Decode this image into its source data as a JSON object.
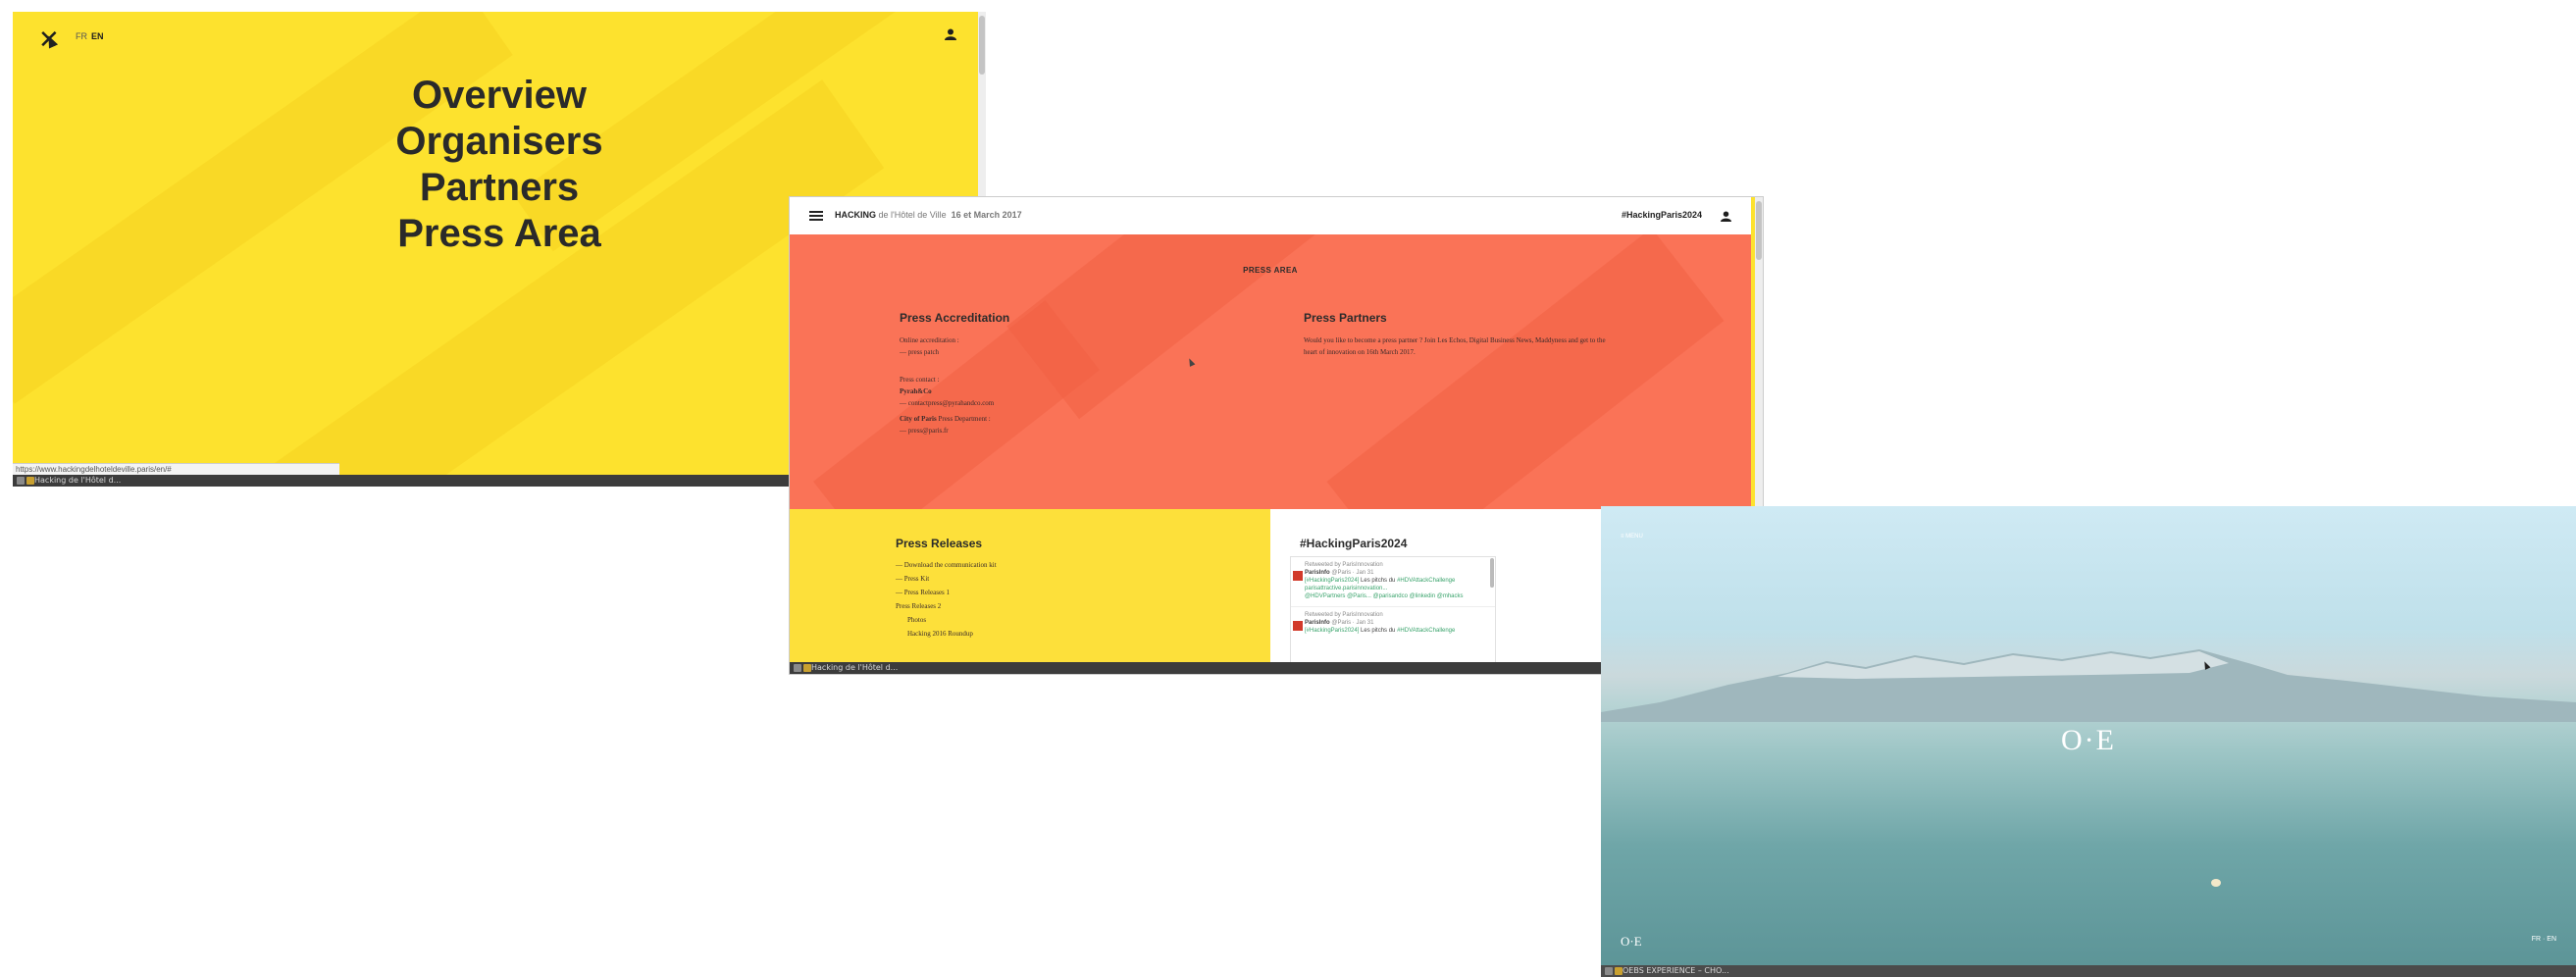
{
  "menu_window": {
    "close_glyph": "✕",
    "lang": [
      "FR",
      "EN"
    ],
    "active_lang": "EN",
    "nav": [
      "Overview",
      "Organisers",
      "Partners",
      "Press Area"
    ],
    "status_url": "https://www.hackingdelhoteldeville.paris/en/#",
    "taskbar_title": "Hacking de l'Hôtel d..."
  },
  "press_window": {
    "brand_bold": "HACKING",
    "brand_light": "de l'Hôtel de Ville",
    "brand_date": "16 et March 2017",
    "hashtag": "#HackingParis2024",
    "section_title": "PRESS AREA",
    "accreditation": {
      "title": "Press Accreditation",
      "online_label": "Online accreditation :",
      "online_link": "— press patch",
      "contact_label": "Press contact :",
      "contact_org": "Pyrah&Co",
      "contact_email": "— contactpress@pyrahandco.com",
      "city_bold": "City of Paris",
      "city_rest": "Press Department :",
      "city_email": "— press@paris.fr"
    },
    "partners": {
      "title": "Press Partners",
      "text_line1": "Would you like to become a press partner ? Join Les Echos, Digital Business News, Maddyness and get to the",
      "text_line2": "heart of innovation on 16th March 2017."
    },
    "releases": {
      "title": "Press Releases",
      "items": [
        "— Download the communication kit",
        "— Press Kit",
        "— Press Releases 1",
        "Press Releases 2",
        "Photos",
        "Hacking 2016 Roundup"
      ]
    },
    "twitter": {
      "title": "#HackingParis2024",
      "tweets": [
        {
          "retweet": "Retweeted by ParisInnovation",
          "author": "ParisInfo",
          "handle": "@Paris · Jan 31",
          "text_hl": "[#HackingParis2024]",
          "text": " Les pitchs du ",
          "text_hl2": "#HDVAttackChallenge",
          "text2": " parisattractive.parisinnovation...",
          "text3": "@HDVPartners @Paris... @parisandco @linkedin @mhacks"
        },
        {
          "retweet": "Retweeted by ParisInnovation",
          "author": "ParisInfo",
          "handle": "@Paris · Jan 31",
          "text_hl": "[#HackingParis2024]",
          "text": " Les pitchs du ",
          "text_hl2": "#HDVAttackChallenge",
          "text2": "",
          "text3": ""
        }
      ]
    },
    "taskbar_title": "Hacking de l'Hôtel d..."
  },
  "lake_window": {
    "menu_label": "≡ MENU",
    "logo": "O·E",
    "logo_small": "O·E",
    "lang": "FR · EN",
    "taskbar_title": "OEBS EXPERIENCE – CHO..."
  }
}
